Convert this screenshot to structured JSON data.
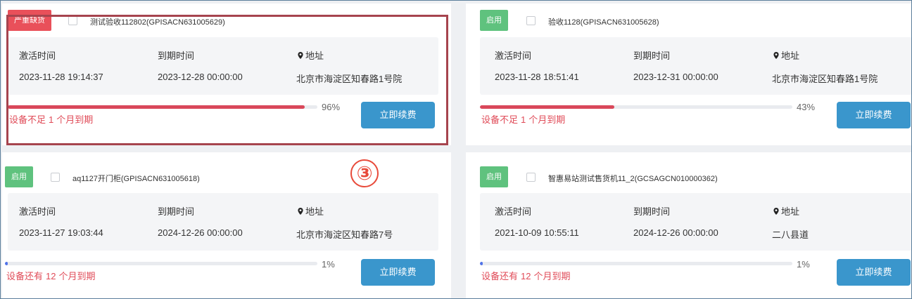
{
  "colors": {
    "badge_shortage": "#e9505a",
    "badge_enabled": "#5fc27e",
    "bar_low": "#d9475a",
    "bar_ok": "#4f72e8",
    "button": "#3a96cc",
    "highlight_border": "#a6444e",
    "step_marker": "#e84a3a"
  },
  "labels": {
    "activation": "激活时间",
    "expiry": "到期时间",
    "address": "地址",
    "renew_button": "立即续费",
    "unit": "个月到期"
  },
  "step_marker": "③",
  "cards": [
    {
      "badge": "严重缺货",
      "badge_type": "shortage",
      "name": "测试验收112802(GPISACN631005629)",
      "activation_time": "2023-11-28 19:14:37",
      "expiry_time": "2023-12-28 00:00:00",
      "address": "北京市海淀区知春路1号院",
      "progress_fraction": 0.96,
      "progress_text": "96%",
      "status_prefix": "设备不足",
      "status_months": "1",
      "highlighted": true
    },
    {
      "badge": "启用",
      "badge_type": "enabled",
      "name": "验收1128(GPISACN631005628)",
      "activation_time": "2023-11-28 18:51:41",
      "expiry_time": "2023-12-31 00:00:00",
      "address": "北京市海淀区知春路1号院",
      "progress_fraction": 0.43,
      "progress_text": "43%",
      "status_prefix": "设备不足",
      "status_months": "1",
      "highlighted": false
    },
    {
      "badge": "启用",
      "badge_type": "enabled",
      "name": "aq1127开门柜(GPISACN631005618)",
      "activation_time": "2023-11-27 19:03:44",
      "expiry_time": "2024-12-26 00:00:00",
      "address": "北京市海淀区知春路7号",
      "progress_fraction": 0.01,
      "progress_text": "1%",
      "status_prefix": "设备还有",
      "status_months": "12",
      "highlighted": false
    },
    {
      "badge": "启用",
      "badge_type": "enabled",
      "name": "智惠易站测试售货机11_2(GCSAGCN010000362)",
      "activation_time": "2021-10-09 10:55:11",
      "expiry_time": "2024-12-26 00:00:00",
      "address": "二八县道",
      "progress_fraction": 0.01,
      "progress_text": "1%",
      "status_prefix": "设备还有",
      "status_months": "12",
      "highlighted": false
    }
  ]
}
